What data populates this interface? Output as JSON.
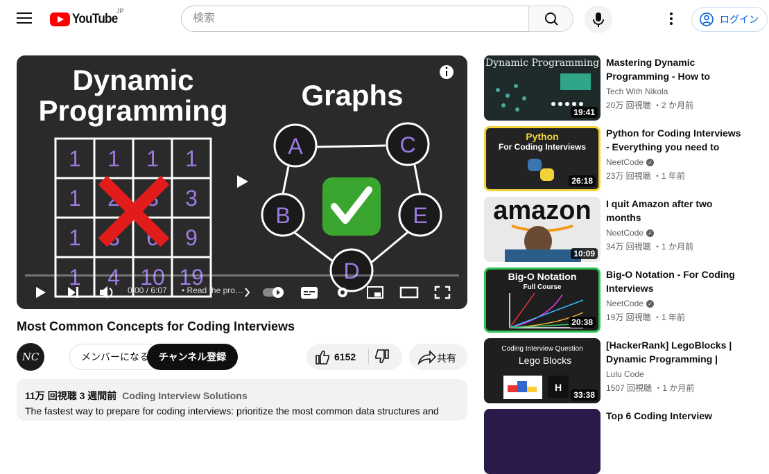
{
  "header": {
    "logo_text": "YouTube",
    "region": "JP",
    "search_placeholder": "検索",
    "login_label": "ログイン"
  },
  "player": {
    "thumb_title_left_line1": "Dynamic",
    "thumb_title_left_line2": "Programming",
    "thumb_title_right": "Graphs",
    "grid_cells": [
      "1",
      "1",
      "1",
      "1",
      "1",
      "2",
      "3",
      "3",
      "1",
      "3",
      "6",
      "9",
      "1",
      "4",
      "10",
      "19"
    ],
    "graph_nodes": [
      "A",
      "C",
      "B",
      "E",
      "D"
    ],
    "time": "0:00 / 6:07",
    "chapter": "• Read the pro…",
    "progress": 0
  },
  "video": {
    "title": "Most Common Concepts for Coding Interviews",
    "channel_avatar": "NC",
    "join_label": "メンバーになる",
    "subscribe_label": "チャンネル登録",
    "like_count": "6152",
    "share_label": "共有",
    "views": "11万 回視聴",
    "age": "3 週間前",
    "tag": "Coding Interview Solutions",
    "description": "The fastest way to prepare for coding interviews: prioritize the most common data structures and"
  },
  "recommendations": [
    {
      "thumb_text": "Dynamic Programming",
      "duration": "19:41",
      "title": "Mastering Dynamic Programming - How to solve…",
      "channel": "Tech With Nikola",
      "verified": false,
      "meta": "20万 回視聴 ・2 か月前"
    },
    {
      "thumb_text_1": "Python",
      "thumb_text_2": "For Coding Interviews",
      "duration": "26:18",
      "title": "Python for Coding Interviews - Everything you need to Know",
      "channel": "NeetCode",
      "verified": true,
      "meta": "23万 回視聴 ・1 年前"
    },
    {
      "thumb_text": "amazon",
      "duration": "10:09",
      "title": "I quit Amazon after two months",
      "channel": "NeetCode",
      "verified": true,
      "meta": "34万 回視聴 ・1 か月前"
    },
    {
      "thumb_text_1": "Big-O Notation",
      "thumb_text_2": "Full Course",
      "duration": "20:38",
      "title": "Big-O Notation - For Coding Interviews",
      "channel": "NeetCode",
      "verified": true,
      "meta": "19万 回視聴 ・1 年前"
    },
    {
      "thumb_text_1": "Coding Interview Question",
      "thumb_text_2": "Lego Blocks",
      "duration": "33:38",
      "title": "[HackerRank] LegoBlocks | Dynamic Programming | Pytho…",
      "channel": "Lulu Code",
      "verified": false,
      "meta": "1507 回視聴 ・1 か月前"
    },
    {
      "title": "Top 6 Coding Interview"
    }
  ]
}
